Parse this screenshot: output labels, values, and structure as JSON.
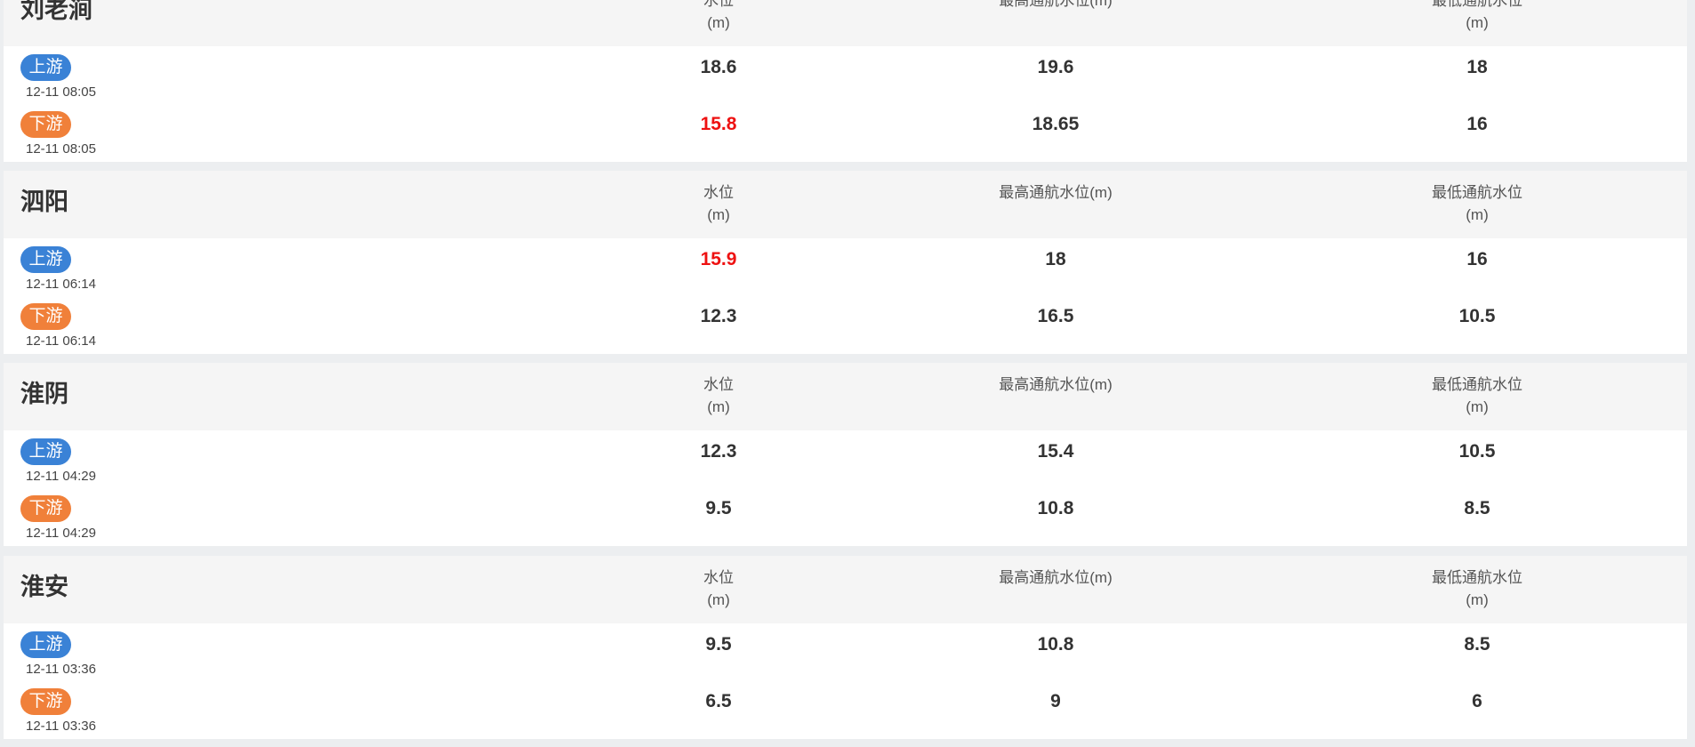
{
  "columns": {
    "water_level": {
      "label": "水位",
      "unit": "(m)"
    },
    "max_nav": {
      "label": "最高通航水位(m)"
    },
    "min_nav": {
      "label": "最低通航水位",
      "unit": "(m)"
    }
  },
  "badges": {
    "up": "上游",
    "down": "下游"
  },
  "colors": {
    "up_badge": "#3a82d6",
    "down_badge": "#f0803a",
    "alert_value": "#ee1111"
  },
  "stations": [
    {
      "name": "刘老涧",
      "up": {
        "time": "12-11 08:05",
        "level": "18.6",
        "max": "19.6",
        "min": "18",
        "alert": false
      },
      "down": {
        "time": "12-11 08:05",
        "level": "15.8",
        "max": "18.65",
        "min": "16",
        "alert": true
      }
    },
    {
      "name": "泗阳",
      "up": {
        "time": "12-11 06:14",
        "level": "15.9",
        "max": "18",
        "min": "16",
        "alert": true
      },
      "down": {
        "time": "12-11 06:14",
        "level": "12.3",
        "max": "16.5",
        "min": "10.5",
        "alert": false
      }
    },
    {
      "name": "淮阴",
      "up": {
        "time": "12-11 04:29",
        "level": "12.3",
        "max": "15.4",
        "min": "10.5",
        "alert": false
      },
      "down": {
        "time": "12-11 04:29",
        "level": "9.5",
        "max": "10.8",
        "min": "8.5",
        "alert": false
      }
    },
    {
      "name": "淮安",
      "up": {
        "time": "12-11 03:36",
        "level": "9.5",
        "max": "10.8",
        "min": "8.5",
        "alert": false
      },
      "down": {
        "time": "12-11 03:36",
        "level": "6.5",
        "max": "9",
        "min": "6",
        "alert": false
      }
    }
  ]
}
